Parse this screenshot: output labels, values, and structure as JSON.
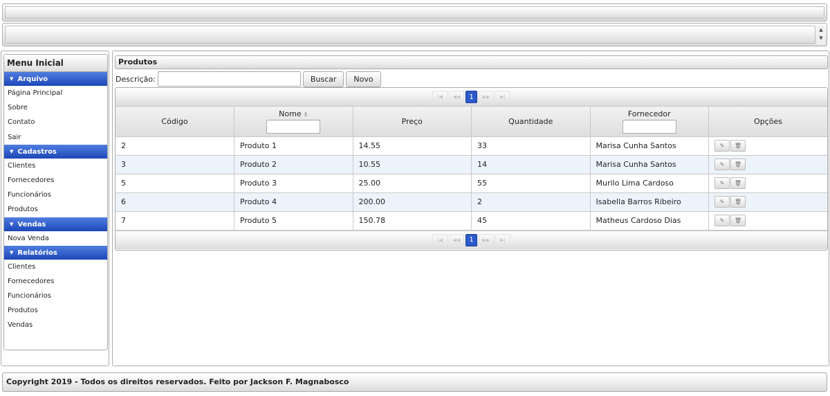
{
  "menu": {
    "title": "Menu Inicial",
    "sections": [
      {
        "title": "Arquivo",
        "items": [
          "Página Principal",
          "Sobre",
          "Contato",
          "Sair"
        ]
      },
      {
        "title": "Cadastros",
        "items": [
          "Clientes",
          "Fornecedores",
          "Funcionários",
          "Produtos"
        ]
      },
      {
        "title": "Vendas",
        "items": [
          "Nova Venda"
        ]
      },
      {
        "title": "Relatórios",
        "items": [
          "Clientes",
          "Fornecedores",
          "Funcionários",
          "Produtos",
          "Vendas"
        ]
      }
    ]
  },
  "main": {
    "panel_title": "Produtos",
    "search": {
      "label": "Descrição:",
      "value": "",
      "search_button": "Buscar",
      "new_button": "Novo"
    },
    "paginator": {
      "current_page": "1"
    },
    "table": {
      "columns": [
        "Código",
        "Nome",
        "Preço",
        "Quantidade",
        "Fornecedor",
        "Opções"
      ],
      "rows": [
        {
          "codigo": "2",
          "nome": "Produto 1",
          "preco": "14.55",
          "quantidade": "33",
          "fornecedor": "Marisa Cunha Santos"
        },
        {
          "codigo": "3",
          "nome": "Produto 2",
          "preco": "10.55",
          "quantidade": "14",
          "fornecedor": "Marisa Cunha Santos"
        },
        {
          "codigo": "5",
          "nome": "Produto 3",
          "preco": "25.00",
          "quantidade": "55",
          "fornecedor": "Murilo Lima Cardoso"
        },
        {
          "codigo": "6",
          "nome": "Produto 4",
          "preco": "200.00",
          "quantidade": "2",
          "fornecedor": "Isabella Barros Ribeiro"
        },
        {
          "codigo": "7",
          "nome": "Produto 5",
          "preco": "150.78",
          "quantidade": "45",
          "fornecedor": "Matheus Cardoso Dias"
        }
      ]
    }
  },
  "footer": {
    "text": "Copyright 2019 - Todos os direitos reservados. Feito por Jackson F. Magnabosco"
  },
  "colors": {
    "menu_header": "#2d5bc9",
    "row_alt": "#edf3fb",
    "page_active": "#2d5bc9"
  },
  "icons": {
    "edit": "pencil-icon",
    "delete": "trash-icon"
  }
}
